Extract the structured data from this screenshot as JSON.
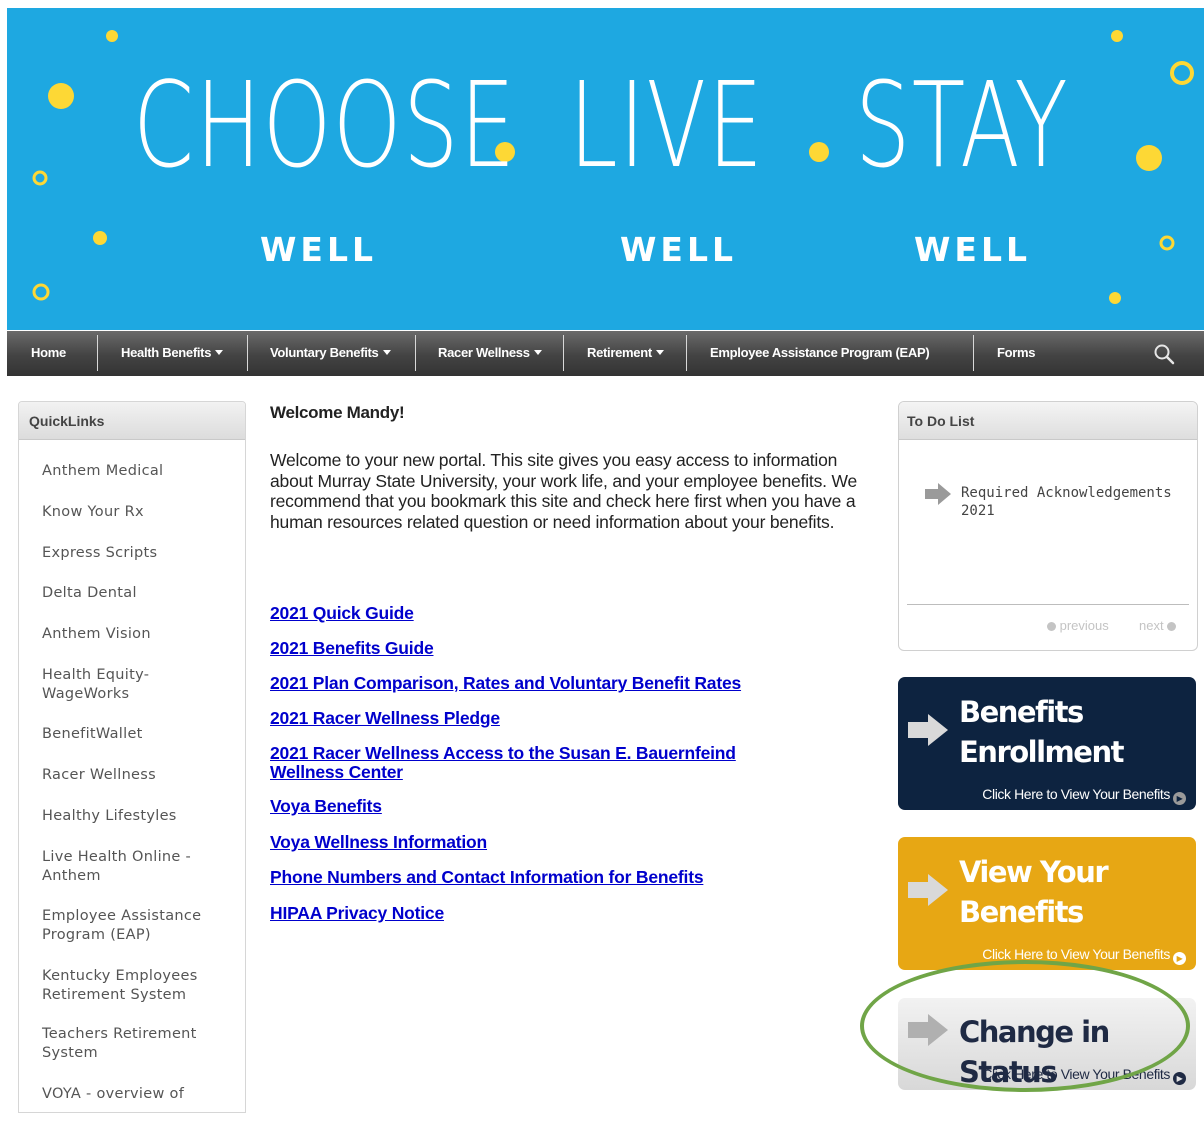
{
  "banner": {
    "title_words": [
      "CHOOSE",
      "LIVE",
      "STAY"
    ],
    "subtitle": "WELL",
    "colors": {
      "background": "#1ea8e1",
      "dots": "#fdd835",
      "text": "#ffffff"
    }
  },
  "nav": {
    "items": [
      {
        "label": "Home",
        "dropdown": false
      },
      {
        "label": "Health Benefits",
        "dropdown": true
      },
      {
        "label": "Voluntary Benefits",
        "dropdown": true
      },
      {
        "label": "Racer Wellness",
        "dropdown": true
      },
      {
        "label": "Retirement",
        "dropdown": true
      },
      {
        "label": "Employee Assistance Program (EAP)",
        "dropdown": false
      },
      {
        "label": "Forms",
        "dropdown": false
      }
    ],
    "search_icon": "search-icon"
  },
  "quicklinks": {
    "title": "QuickLinks",
    "items": [
      "Anthem Medical",
      "Know Your Rx",
      "Express Scripts",
      "Delta Dental",
      "Anthem Vision",
      "Health Equity-WageWorks",
      "BenefitWallet",
      "Racer Wellness",
      "Healthy Lifestyles",
      "Live Health Online - Anthem",
      "Employee Assistance Program (EAP)",
      "Kentucky Employees Retirement System",
      "Teachers Retirement System",
      "VOYA - overview of"
    ]
  },
  "main": {
    "welcome_title": "Welcome Mandy!",
    "welcome_text": "Welcome to your new portal. This site gives you easy access to information about Murray State University, your work life, and your employee benefits. We recommend that you bookmark this site and check here first when you have a human resources related question or need information about your benefits.",
    "links": [
      "2021 Quick Guide",
      "2021 Benefits Guide",
      "2021 Plan Comparison, Rates and Voluntary Benefit Rates",
      "2021 Racer Wellness Pledge",
      "2021 Racer Wellness Access to the Susan E. Bauernfeind Wellness Center",
      "Voya Benefits",
      "Voya Wellness Information",
      "Phone Numbers and Contact Information for Benefits",
      "HIPAA Privacy Notice"
    ]
  },
  "todo": {
    "title": "To Do List",
    "items": [
      "Required Acknowledgements 2021"
    ],
    "previous": "previous",
    "next": "next"
  },
  "tiles": [
    {
      "line1": "Benefits",
      "line2": "Enrollment",
      "subtitle": "Click Here to View Your Benefits",
      "background": "#0d2340"
    },
    {
      "line1": "View Your",
      "line2": "Benefits",
      "subtitle": "Click Here to View Your Benefits",
      "background": "#e7a714"
    },
    {
      "line1": "Change in Status",
      "line2": "",
      "subtitle": "Click Here to View Your Benefits",
      "background": "#e3e3e3"
    }
  ],
  "highlight_color": "#70a547"
}
